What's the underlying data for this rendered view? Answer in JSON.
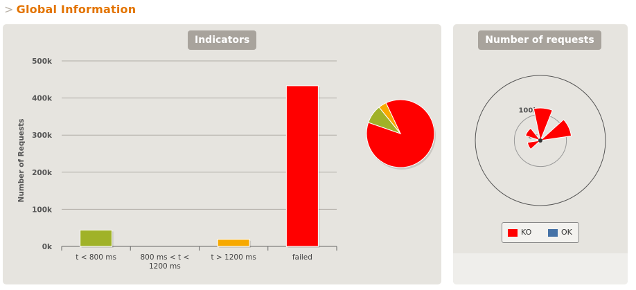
{
  "section": {
    "arrow": ">",
    "title": "Global Information"
  },
  "indicators": {
    "title": "Indicators",
    "chart_data": {
      "type": "bar",
      "ylabel": "Number of Requests",
      "ylim": [
        0,
        500000
      ],
      "yticks": [
        {
          "v": 0,
          "label": "0k"
        },
        {
          "v": 100000,
          "label": "100k"
        },
        {
          "v": 200000,
          "label": "200k"
        },
        {
          "v": 300000,
          "label": "300k"
        },
        {
          "v": 400000,
          "label": "400k"
        },
        {
          "v": 500000,
          "label": "500k"
        }
      ],
      "categories": [
        {
          "lines": [
            "t < 800 ms"
          ]
        },
        {
          "lines": [
            "800 ms < t <",
            "1200 ms"
          ]
        },
        {
          "lines": [
            "t > 1200 ms"
          ]
        },
        {
          "lines": [
            "failed"
          ]
        }
      ],
      "values": [
        44000,
        0,
        19000,
        433000
      ],
      "colors": [
        "#a0b228",
        "#f7a900",
        "#f7a900",
        "#ff0000"
      ]
    },
    "pie": {
      "type": "pie",
      "values": [
        433000,
        44000,
        19000
      ],
      "colors": [
        "#ff0000",
        "#a0b228",
        "#f7a900"
      ]
    }
  },
  "requests": {
    "title": "Number of requests",
    "chart_data": {
      "type": "polar-bar",
      "rings": [
        {
          "v": 0,
          "label": "0k"
        },
        {
          "v": 100000,
          "label": "100k"
        }
      ],
      "rmax": 250000,
      "ko_values": [
        125000,
        120000,
        8000,
        5000,
        50000,
        60000
      ],
      "ok_values": [
        0,
        0,
        0,
        0,
        0,
        0
      ],
      "series_colors": {
        "KO": "#ff0000",
        "OK": "#4572a7"
      }
    },
    "legend": [
      {
        "name": "KO",
        "color": "#ff0000"
      },
      {
        "name": "OK",
        "color": "#4572a7"
      }
    ]
  }
}
